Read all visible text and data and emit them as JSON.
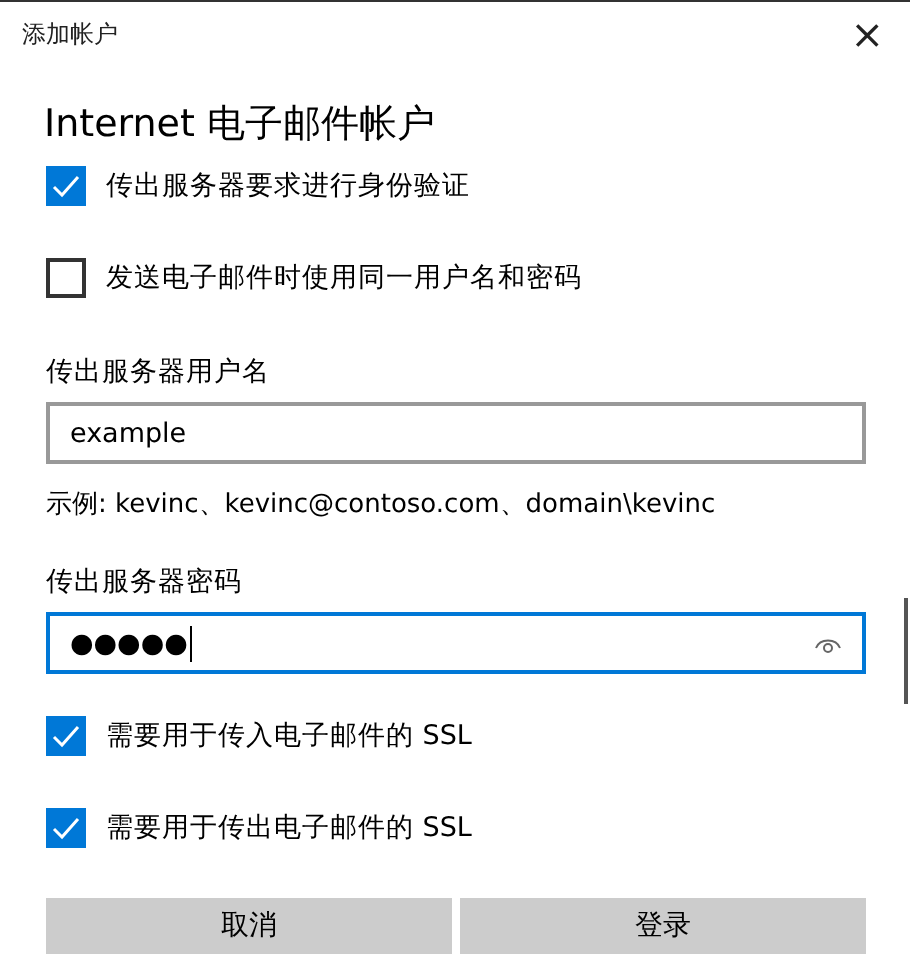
{
  "window": {
    "title": "添加帐户",
    "close": "×"
  },
  "heading": "Internet 电子邮件帐户",
  "options_top": [
    {
      "label": "传出服务器要求进行身份验证",
      "checked": true
    },
    {
      "label": "发送电子邮件时使用同一用户名和密码",
      "checked": false
    }
  ],
  "username": {
    "label": "传出服务器用户名",
    "value": "example",
    "hint": "示例: kevinc、kevinc@contoso.com、domain\\kevinc"
  },
  "password": {
    "label": "传出服务器密码",
    "value": "●●●●●",
    "focused": true
  },
  "options_bottom": [
    {
      "label": "需要用于传入电子邮件的 SSL",
      "checked": true
    },
    {
      "label": "需要用于传出电子邮件的 SSL",
      "checked": true
    }
  ],
  "buttons": [
    "取消",
    "登录"
  ]
}
